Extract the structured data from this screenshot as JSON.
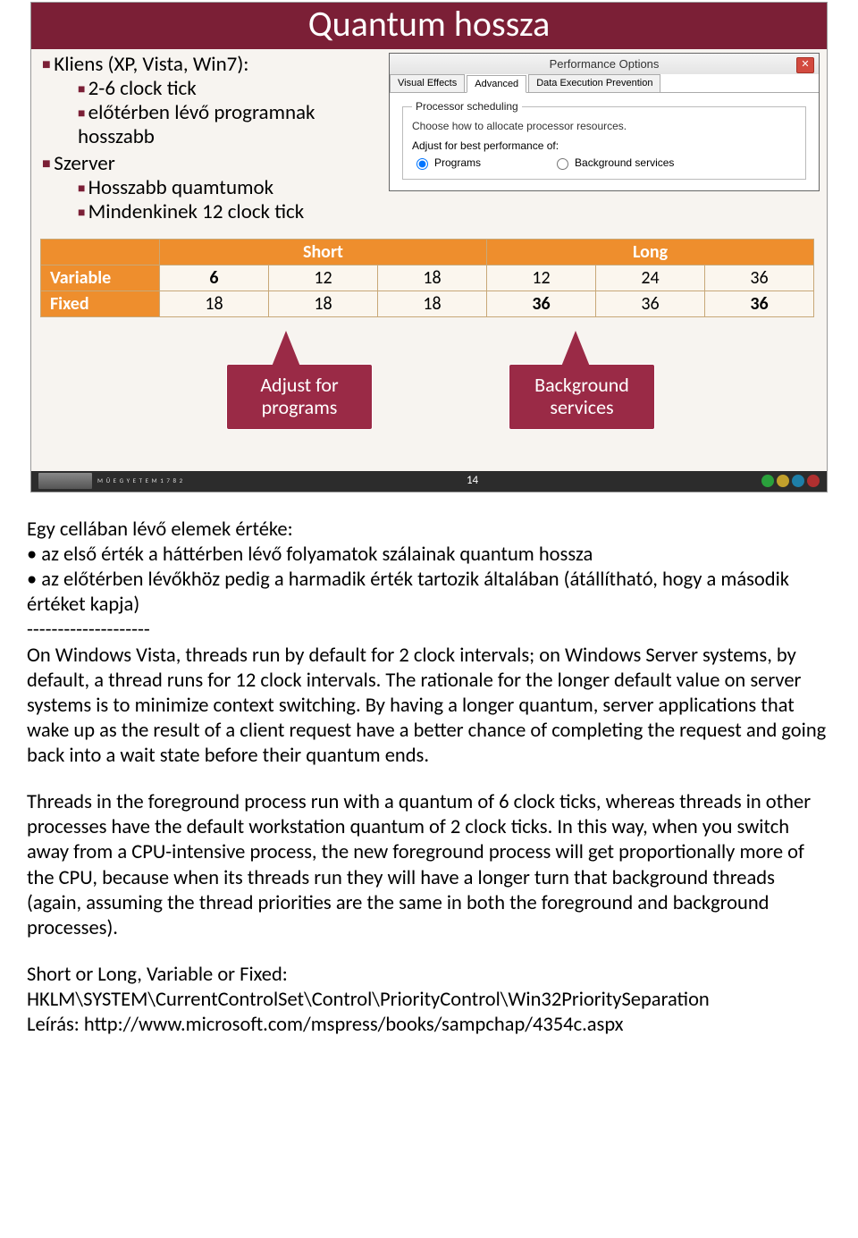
{
  "slide": {
    "title": "Quantum hossza",
    "bullets": {
      "client": {
        "head": "Kliens (XP, Vista, Win7):",
        "sub1": "2-6 clock tick",
        "sub2a": "előtérben lévő programnak",
        "sub2b": "hosszabb"
      },
      "server": {
        "head": "Szerver",
        "sub1": "Hosszabb quamtumok",
        "sub2": "Mindenkinek 12 clock tick"
      }
    },
    "dialog": {
      "title": "Performance Options",
      "tabs": {
        "t1": "Visual Effects",
        "t2": "Advanced",
        "t3": "Data Execution Prevention"
      },
      "legend": "Processor scheduling",
      "desc": "Choose how to allocate processor resources.",
      "adjust": "Adjust for best performance of:",
      "opt_programs": "Programs",
      "opt_services": "Background services"
    },
    "table": {
      "h_short": "Short",
      "h_long": "Long",
      "r1_label": "Variable",
      "r1": [
        "6",
        "12",
        "18",
        "12",
        "24",
        "36"
      ],
      "r2_label": "Fixed",
      "r2": [
        "18",
        "18",
        "18",
        "36",
        "36",
        "36"
      ]
    },
    "callouts": {
      "c1a": "Adjust for",
      "c1b": "programs",
      "c2a": "Background",
      "c2b": "services"
    },
    "footer": {
      "page": "14",
      "logotext": "M Ű E G Y E T E M  1 7 8 2"
    }
  },
  "notes": {
    "p1a": "Egy cellában lévő elemek értéke:",
    "p1b": "• az első érték a háttérben lévő folyamatok szálainak quantum hossza",
    "p1c": "• az előtérben lévőkhöz pedig a harmadik érték tartozik  általában (átállítható, hogy a második értéket kapja)",
    "p1d": "--------------------",
    "p2": "On Windows Vista, threads run by default for 2 clock intervals; on Windows Server systems, by default, a thread runs for 12 clock intervals. The rationale for the longer default value on server systems is to minimize context switching. By having a longer quantum, server applications that wake up as the result of a client request have a better chance of completing the request and going back into a wait state before their quantum ends.",
    "p3": "Threads in the foreground process run with a quantum of 6 clock ticks, whereas threads in other processes have the default workstation quantum of 2 clock ticks. In this way, when you switch away from a CPU-intensive process, the new foreground process will get proportionally more of the CPU, because when its threads run they will have a longer turn that background threads (again, assuming the thread priorities are the same in both the foreground and background processes).",
    "p4a": "Short or Long, Variable or Fixed:",
    "p4b": "HKLM\\SYSTEM\\CurrentControlSet\\Control\\PriorityControl\\Win32PrioritySeparation",
    "p4c": "Leírás: http://www.microsoft.com/mspress/books/sampchap/4354c.aspx"
  }
}
